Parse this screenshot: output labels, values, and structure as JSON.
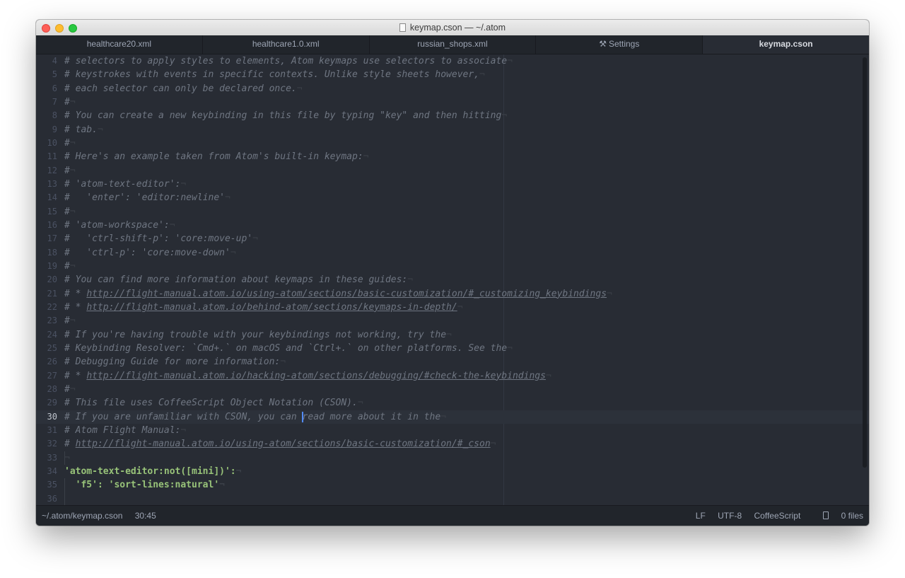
{
  "window": {
    "title": "keymap.cson — ~/.atom"
  },
  "tabs": [
    {
      "label": "healthcare20.xml",
      "active": false
    },
    {
      "label": "healthcare1.0.xml",
      "active": false
    },
    {
      "label": "russian_shops.xml",
      "active": false
    },
    {
      "label": "Settings",
      "active": false,
      "icon": "tools-icon"
    },
    {
      "label": "keymap.cson",
      "active": true
    }
  ],
  "editor": {
    "invisible_char": "¬",
    "lines": [
      {
        "number": "4",
        "text": "# selectors to apply styles to elements, Atom keymaps use selectors to associate"
      },
      {
        "number": "5",
        "text": "# keystrokes with events in specific contexts. Unlike style sheets however,"
      },
      {
        "number": "6",
        "text": "# each selector can only be declared once."
      },
      {
        "number": "7",
        "text": "#"
      },
      {
        "number": "8",
        "text": "# You can create a new keybinding in this file by typing \"key\" and then hitting"
      },
      {
        "number": "9",
        "text": "# tab."
      },
      {
        "number": "10",
        "text": "#"
      },
      {
        "number": "11",
        "text": "# Here's an example taken from Atom's built-in keymap:"
      },
      {
        "number": "12",
        "text": "#"
      },
      {
        "number": "13",
        "text": "# 'atom-text-editor':"
      },
      {
        "number": "14",
        "text": "#   'enter': 'editor:newline'"
      },
      {
        "number": "15",
        "text": "#"
      },
      {
        "number": "16",
        "text": "# 'atom-workspace':"
      },
      {
        "number": "17",
        "text": "#   'ctrl-shift-p': 'core:move-up'"
      },
      {
        "number": "18",
        "text": "#   'ctrl-p': 'core:move-down'"
      },
      {
        "number": "19",
        "text": "#"
      },
      {
        "number": "20",
        "text": "# You can find more information about keymaps in these guides:"
      },
      {
        "number": "21",
        "text": "# * ",
        "link": "http://flight-manual.atom.io/using-atom/sections/basic-customization/#_customizing_keybindings"
      },
      {
        "number": "22",
        "text": "# * ",
        "link": "http://flight-manual.atom.io/behind-atom/sections/keymaps-in-depth/"
      },
      {
        "number": "23",
        "text": "#"
      },
      {
        "number": "24",
        "text": "# If you're having trouble with your keybindings not working, try the"
      },
      {
        "number": "25",
        "text": "# Keybinding Resolver: `Cmd+.` on macOS and `Ctrl+.` on other platforms. See the"
      },
      {
        "number": "26",
        "text": "# Debugging Guide for more information:"
      },
      {
        "number": "27",
        "text": "# * ",
        "link": "http://flight-manual.atom.io/hacking-atom/sections/debugging/#check-the-keybindings"
      },
      {
        "number": "28",
        "text": "#"
      },
      {
        "number": "29",
        "text": "# This file uses CoffeeScript Object Notation (CSON)."
      },
      {
        "number": "30",
        "text": "# If you are unfamiliar with CSON, you can read more about it in the",
        "cursor": true
      },
      {
        "number": "31",
        "text": "# Atom Flight Manual:"
      },
      {
        "number": "32",
        "text": "# ",
        "link": "http://flight-manual.atom.io/using-atom/sections/basic-customization/#_cson"
      },
      {
        "number": "33",
        "text": ""
      },
      {
        "number": "34",
        "text": "'atom-text-editor:not([mini])':",
        "syntax": true
      },
      {
        "number": "35",
        "text": "  'f5': 'sort-lines:natural'",
        "syntax": true
      },
      {
        "number": "36",
        "text": "",
        "noeol": true
      }
    ]
  },
  "status": {
    "path": "~/.atom/keymap.cson",
    "cursor_position": "30:45",
    "line_ending": "LF",
    "encoding": "UTF-8",
    "grammar": "CoffeeScript",
    "files": "0 files"
  }
}
